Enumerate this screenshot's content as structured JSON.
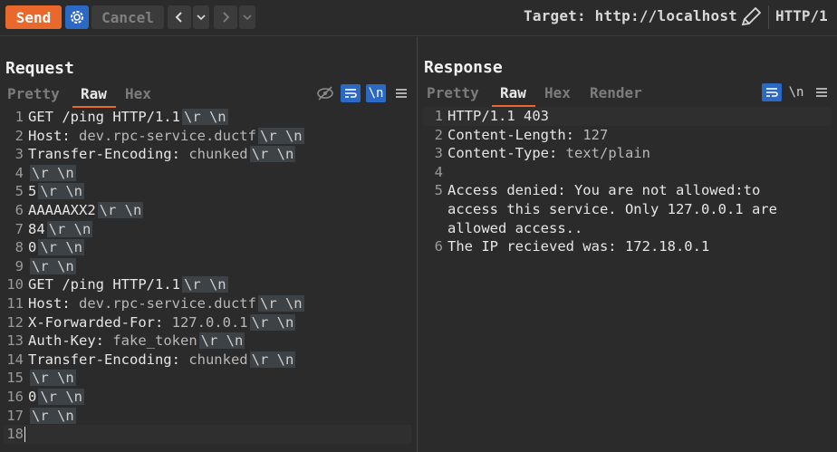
{
  "toolbar": {
    "send_label": "Send",
    "cancel_label": "Cancel",
    "target_label": "Target: http://localhost",
    "http_version": "HTTP/1"
  },
  "request": {
    "title": "Request",
    "tabs": [
      {
        "label": "Pretty"
      },
      {
        "label": "Raw"
      },
      {
        "label": "Hex"
      }
    ],
    "newline_icon_label": "\\n",
    "lines": [
      {
        "n": "1",
        "text": "GET /ping HTTP/1.1",
        "crlf": "\\r \\n"
      },
      {
        "n": "2",
        "key": "Host:",
        "val": " dev.rpc-service.ductf",
        "crlf": "\\r \\n"
      },
      {
        "n": "3",
        "key": "Transfer-Encoding:",
        "val": " chunked",
        "crlf": "\\r \\n"
      },
      {
        "n": "4",
        "text": "",
        "crlf": "\\r \\n"
      },
      {
        "n": "5",
        "text": "5",
        "crlf": "\\r \\n"
      },
      {
        "n": "6",
        "text": "AAAAAXX2",
        "crlf": "\\r \\n"
      },
      {
        "n": "7",
        "text": "84",
        "crlf": "\\r \\n"
      },
      {
        "n": "8",
        "text": "0",
        "crlf": "\\r \\n"
      },
      {
        "n": "9",
        "text": "",
        "crlf": "\\r \\n"
      },
      {
        "n": "10",
        "text": "GET /ping HTTP/1.1",
        "crlf": "\\r \\n"
      },
      {
        "n": "11",
        "key": "Host:",
        "val": " dev.rpc-service.ductf",
        "crlf": "\\r \\n"
      },
      {
        "n": "12",
        "key": "X-Forwarded-For:",
        "val": " 127.0.0.1",
        "crlf": "\\r \\n"
      },
      {
        "n": "13",
        "key": "Auth-Key:",
        "val": " fake_token",
        "crlf": "\\r \\n"
      },
      {
        "n": "14",
        "key": "Transfer-Encoding:",
        "val": " chunked",
        "crlf": "\\r \\n"
      },
      {
        "n": "15",
        "text": "",
        "crlf": "\\r \\n"
      },
      {
        "n": "16",
        "text": "0",
        "crlf": "\\r \\n"
      },
      {
        "n": "17",
        "text": "",
        "crlf": "\\r \\n"
      },
      {
        "n": "18",
        "text": "",
        "crlf": ""
      }
    ]
  },
  "response": {
    "title": "Response",
    "tabs": [
      {
        "label": "Pretty"
      },
      {
        "label": "Raw"
      },
      {
        "label": "Hex"
      },
      {
        "label": "Render"
      }
    ],
    "newline_icon_label": "\\n",
    "lines": [
      {
        "n": "1",
        "text": "HTTP/1.1 403"
      },
      {
        "n": "2",
        "key": "Content-Length:",
        "val": " 127"
      },
      {
        "n": "3",
        "key": "Content-Type:",
        "val": " text/plain"
      },
      {
        "n": "4",
        "text": ""
      },
      {
        "n": "5",
        "text": "Access denied: You are not allowed:to"
      },
      {
        "n": "",
        "text": "access this service. Only 127.0.0.1 are"
      },
      {
        "n": "",
        "text": "allowed access.."
      },
      {
        "n": "6",
        "text": "The IP recieved was: 172.18.0.1"
      }
    ]
  },
  "colors": {
    "accent_orange": "#e8692b",
    "accent_blue": "#2b69c4",
    "background": "#2b2b2b"
  },
  "icons": [
    "settings-gear-icon",
    "chevron-left-icon",
    "chevron-down-icon",
    "chevron-right-icon",
    "pencil-icon",
    "hide-icon",
    "wrap-icon",
    "newline-icon",
    "hamburger-menu-icon",
    "layout-split-icon",
    "layout-horizontal-icon",
    "layout-single-icon"
  ]
}
